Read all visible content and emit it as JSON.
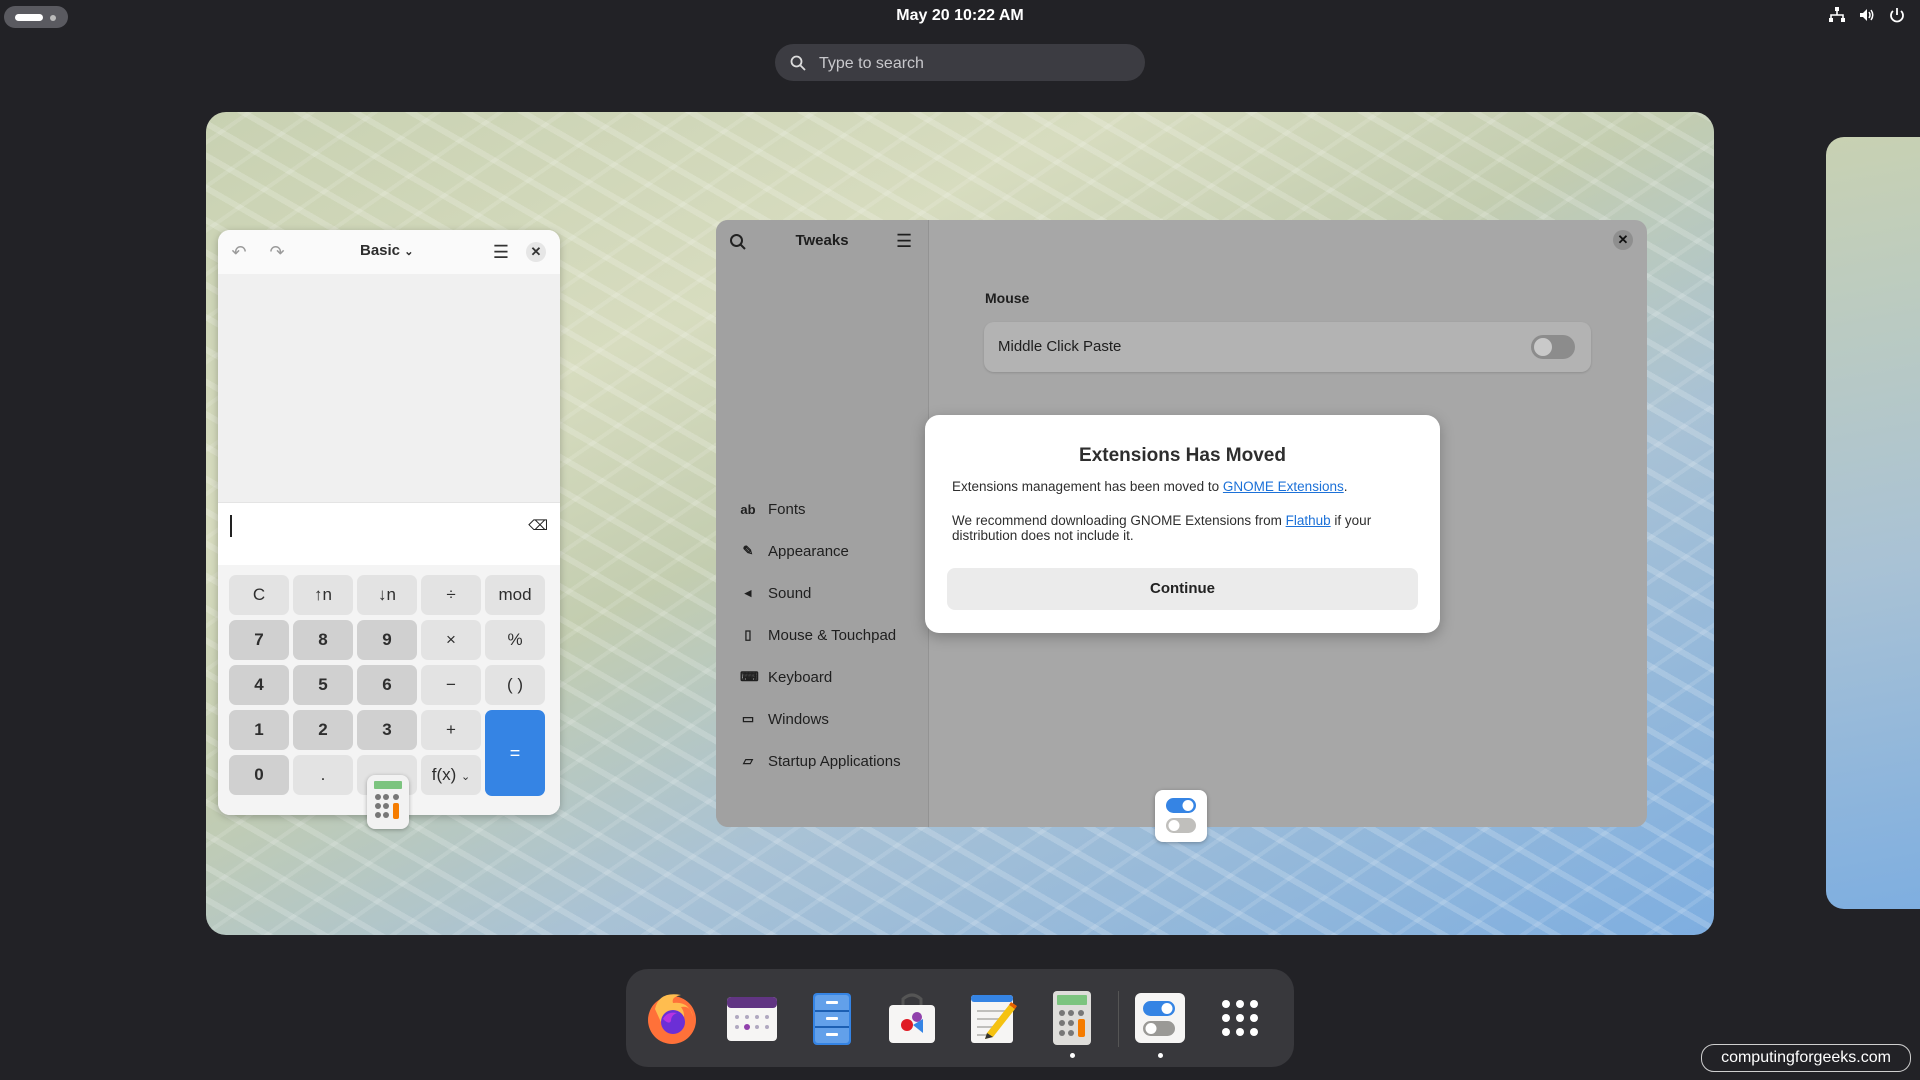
{
  "topbar": {
    "datetime": "May 20  10:22 AM",
    "icons": [
      "network-icon",
      "volume-icon",
      "power-icon"
    ]
  },
  "search": {
    "placeholder": "Type to search"
  },
  "calculator": {
    "mode": "Basic",
    "keys": [
      [
        "C",
        "↑n",
        "↓n",
        "÷",
        "mod"
      ],
      [
        "7",
        "8",
        "9",
        "×",
        "%"
      ],
      [
        "4",
        "5",
        "6",
        "−",
        "( )"
      ],
      [
        "1",
        "2",
        "3",
        "+",
        "="
      ],
      [
        "0",
        ".",
        "",
        "f(x)",
        ""
      ]
    ]
  },
  "tweaks": {
    "title": "Tweaks",
    "sidebar": [
      {
        "icon": "ab",
        "label": "Fonts"
      },
      {
        "icon": "palette",
        "label": "Appearance"
      },
      {
        "icon": "speaker",
        "label": "Sound"
      },
      {
        "icon": "mouse",
        "label": "Mouse & Touchpad"
      },
      {
        "icon": "keyboard",
        "label": "Keyboard"
      },
      {
        "icon": "monitor",
        "label": "Windows"
      },
      {
        "icon": "folder",
        "label": "Startup Applications"
      }
    ],
    "section": "Mouse",
    "row_label": "Middle Click Paste",
    "middle_click_paste": false
  },
  "dialog": {
    "title": "Extensions Has Moved",
    "p1_text": "Extensions management has been moved to ",
    "p1_link": "GNOME Extensions",
    "p1_end": ".",
    "p2_text": "We recommend downloading GNOME Extensions from ",
    "p2_link": "Flathub",
    "p2_end": " if your distribution does not include it.",
    "button": "Continue"
  },
  "dock": [
    {
      "name": "firefox-icon",
      "running": false
    },
    {
      "name": "calendar-icon",
      "running": false
    },
    {
      "name": "files-icon",
      "running": false
    },
    {
      "name": "software-icon",
      "running": false
    },
    {
      "name": "text-editor-icon",
      "running": false
    },
    {
      "name": "calculator-icon",
      "running": true
    },
    {
      "name": "tweaks-icon",
      "running": true
    },
    {
      "name": "app-grid-icon",
      "running": false
    }
  ],
  "watermark": "computingforgeeks.com",
  "colors": {
    "accent": "#3584e4",
    "link": "#1c71d8",
    "panel": "#222226"
  }
}
